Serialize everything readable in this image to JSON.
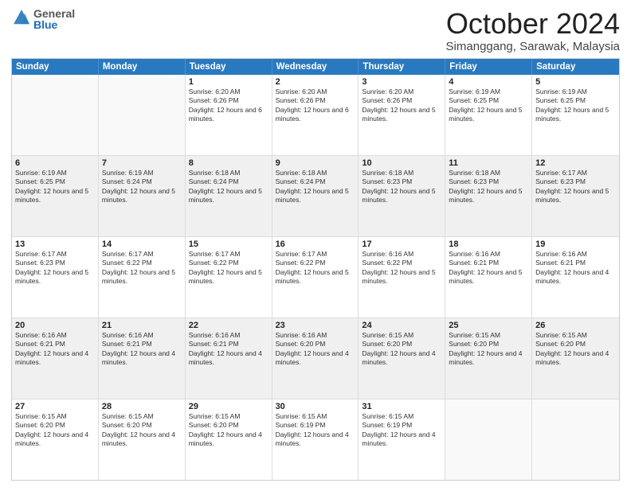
{
  "header": {
    "logo_general": "General",
    "logo_blue": "Blue",
    "title": "October 2024",
    "subtitle": "Simanggang, Sarawak, Malaysia"
  },
  "days_of_week": [
    "Sunday",
    "Monday",
    "Tuesday",
    "Wednesday",
    "Thursday",
    "Friday",
    "Saturday"
  ],
  "weeks": [
    [
      {
        "day": "",
        "empty": true
      },
      {
        "day": "",
        "empty": true
      },
      {
        "day": "1",
        "sunrise": "6:20 AM",
        "sunset": "6:26 PM",
        "daylight": "12 hours and 6 minutes."
      },
      {
        "day": "2",
        "sunrise": "6:20 AM",
        "sunset": "6:26 PM",
        "daylight": "12 hours and 6 minutes."
      },
      {
        "day": "3",
        "sunrise": "6:20 AM",
        "sunset": "6:26 PM",
        "daylight": "12 hours and 5 minutes."
      },
      {
        "day": "4",
        "sunrise": "6:19 AM",
        "sunset": "6:25 PM",
        "daylight": "12 hours and 5 minutes."
      },
      {
        "day": "5",
        "sunrise": "6:19 AM",
        "sunset": "6:25 PM",
        "daylight": "12 hours and 5 minutes."
      }
    ],
    [
      {
        "day": "6",
        "sunrise": "6:19 AM",
        "sunset": "6:25 PM",
        "daylight": "12 hours and 5 minutes."
      },
      {
        "day": "7",
        "sunrise": "6:19 AM",
        "sunset": "6:24 PM",
        "daylight": "12 hours and 5 minutes."
      },
      {
        "day": "8",
        "sunrise": "6:18 AM",
        "sunset": "6:24 PM",
        "daylight": "12 hours and 5 minutes."
      },
      {
        "day": "9",
        "sunrise": "6:18 AM",
        "sunset": "6:24 PM",
        "daylight": "12 hours and 5 minutes."
      },
      {
        "day": "10",
        "sunrise": "6:18 AM",
        "sunset": "6:23 PM",
        "daylight": "12 hours and 5 minutes."
      },
      {
        "day": "11",
        "sunrise": "6:18 AM",
        "sunset": "6:23 PM",
        "daylight": "12 hours and 5 minutes."
      },
      {
        "day": "12",
        "sunrise": "6:17 AM",
        "sunset": "6:23 PM",
        "daylight": "12 hours and 5 minutes."
      }
    ],
    [
      {
        "day": "13",
        "sunrise": "6:17 AM",
        "sunset": "6:23 PM",
        "daylight": "12 hours and 5 minutes."
      },
      {
        "day": "14",
        "sunrise": "6:17 AM",
        "sunset": "6:22 PM",
        "daylight": "12 hours and 5 minutes."
      },
      {
        "day": "15",
        "sunrise": "6:17 AM",
        "sunset": "6:22 PM",
        "daylight": "12 hours and 5 minutes."
      },
      {
        "day": "16",
        "sunrise": "6:17 AM",
        "sunset": "6:22 PM",
        "daylight": "12 hours and 5 minutes."
      },
      {
        "day": "17",
        "sunrise": "6:16 AM",
        "sunset": "6:22 PM",
        "daylight": "12 hours and 5 minutes."
      },
      {
        "day": "18",
        "sunrise": "6:16 AM",
        "sunset": "6:21 PM",
        "daylight": "12 hours and 5 minutes."
      },
      {
        "day": "19",
        "sunrise": "6:16 AM",
        "sunset": "6:21 PM",
        "daylight": "12 hours and 4 minutes."
      }
    ],
    [
      {
        "day": "20",
        "sunrise": "6:16 AM",
        "sunset": "6:21 PM",
        "daylight": "12 hours and 4 minutes."
      },
      {
        "day": "21",
        "sunrise": "6:16 AM",
        "sunset": "6:21 PM",
        "daylight": "12 hours and 4 minutes."
      },
      {
        "day": "22",
        "sunrise": "6:16 AM",
        "sunset": "6:21 PM",
        "daylight": "12 hours and 4 minutes."
      },
      {
        "day": "23",
        "sunrise": "6:16 AM",
        "sunset": "6:20 PM",
        "daylight": "12 hours and 4 minutes."
      },
      {
        "day": "24",
        "sunrise": "6:15 AM",
        "sunset": "6:20 PM",
        "daylight": "12 hours and 4 minutes."
      },
      {
        "day": "25",
        "sunrise": "6:15 AM",
        "sunset": "6:20 PM",
        "daylight": "12 hours and 4 minutes."
      },
      {
        "day": "26",
        "sunrise": "6:15 AM",
        "sunset": "6:20 PM",
        "daylight": "12 hours and 4 minutes."
      }
    ],
    [
      {
        "day": "27",
        "sunrise": "6:15 AM",
        "sunset": "6:20 PM",
        "daylight": "12 hours and 4 minutes."
      },
      {
        "day": "28",
        "sunrise": "6:15 AM",
        "sunset": "6:20 PM",
        "daylight": "12 hours and 4 minutes."
      },
      {
        "day": "29",
        "sunrise": "6:15 AM",
        "sunset": "6:20 PM",
        "daylight": "12 hours and 4 minutes."
      },
      {
        "day": "30",
        "sunrise": "6:15 AM",
        "sunset": "6:19 PM",
        "daylight": "12 hours and 4 minutes."
      },
      {
        "day": "31",
        "sunrise": "6:15 AM",
        "sunset": "6:19 PM",
        "daylight": "12 hours and 4 minutes."
      },
      {
        "day": "",
        "empty": true
      },
      {
        "day": "",
        "empty": true
      }
    ]
  ]
}
